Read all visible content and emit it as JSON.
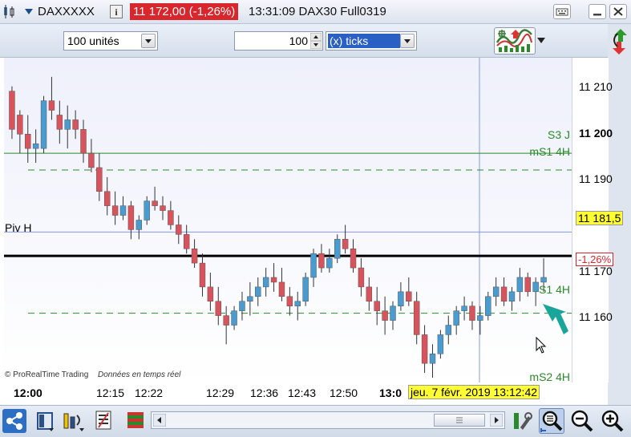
{
  "window": {
    "title_symbol": "DAXXXXX",
    "price_badge": "11 172,00 (-1,26%)",
    "time_and_instrument": "13:31:09 DAX30 Full0319",
    "price_badge_color": "#d9262c",
    "icons": [
      "drag-handle-icon",
      "dropdown-arrow-icon",
      "info-icon",
      "keyboard-icon",
      "minimize-icon",
      "close-icon"
    ]
  },
  "toolbar": {
    "units_select": "100 unités",
    "ticks_value": "100",
    "ticks_mode_select": "(x) ticks",
    "icons": [
      "indicator-chart-icon",
      "menu-arrow-icon",
      "undock-icon"
    ]
  },
  "chart": {
    "watermark": "© ProRealTime Trading",
    "realtime_note": "Données en temps réel",
    "levels": {
      "s3j": "S3 J",
      "ms1_4h": "mS1 4H",
      "piv_h": "Piv H",
      "s1_4h": "S1 4H",
      "ms2_4h": "mS2 4H"
    },
    "y_axis": {
      "ticks": [
        "11 210",
        "11 200",
        "11 190",
        "11 181,5",
        "11 170",
        "11 160"
      ],
      "bold_tick": "11 200",
      "current_price_label": "11 181,5",
      "change_label": "-1,26%"
    },
    "x_axis": {
      "ticks": [
        "12:00",
        "12:15",
        "12:22",
        "12:29",
        "12:36",
        "12:43",
        "12:50",
        "13:0"
      ],
      "cursor_date": "jeu. 7 févr. 2019 13:12:42"
    },
    "colors": {
      "up": "#4a9bcf",
      "down": "#d9535c",
      "support_line": "#2a8a2a",
      "pivot_line": "#000000",
      "cursor_line": "#8899dd",
      "arrow": "#1aa59a"
    }
  },
  "chart_data": {
    "type": "candlestick",
    "ylim": [
      11150,
      11218
    ],
    "y_ticks": [
      11210,
      11200,
      11190,
      11170,
      11160
    ],
    "horizontal_levels": [
      {
        "name": "S3 J",
        "value": 11198
      },
      {
        "name": "mS1 4H",
        "value": 11194.5
      },
      {
        "name": "Piv H",
        "value": 11176.5
      },
      {
        "name": "S1 4H",
        "value": 11164.5
      },
      {
        "name": "mS2 4H",
        "value": 11148
      }
    ],
    "current_price": 11181.5,
    "x": [
      "12:00",
      "12:15",
      "12:22",
      "12:29",
      "12:36",
      "12:43",
      "12:50",
      "13:0"
    ],
    "candles": [
      [
        11211,
        11212,
        11201,
        11203
      ],
      [
        11206,
        11207,
        11198,
        11202
      ],
      [
        11202,
        11206,
        11196,
        11199
      ],
      [
        11199,
        11203,
        11196,
        11200
      ],
      [
        11199,
        11210,
        11198,
        11209
      ],
      [
        11209,
        11214,
        11205,
        11207
      ],
      [
        11206,
        11209,
        11200,
        11203
      ],
      [
        11203,
        11208,
        11199,
        11205
      ],
      [
        11205,
        11207,
        11201,
        11203
      ],
      [
        11203,
        11205,
        11196,
        11198
      ],
      [
        11198,
        11201,
        11194,
        11195
      ],
      [
        11195,
        11198,
        11188,
        11190
      ],
      [
        11190,
        11193,
        11185,
        11187
      ],
      [
        11187,
        11190,
        11183,
        11185
      ],
      [
        11185,
        11189,
        11184,
        11187
      ],
      [
        11187,
        11188,
        11180,
        11182
      ],
      [
        11182,
        11185,
        11180,
        11184
      ],
      [
        11184,
        11189,
        11183,
        11188
      ],
      [
        11188,
        11191,
        11186,
        11187
      ],
      [
        11187,
        11189,
        11184,
        11186
      ],
      [
        11186,
        11188,
        11182,
        11183
      ],
      [
        11183,
        11185,
        11179,
        11181
      ],
      [
        11181,
        11183,
        11177,
        11178
      ],
      [
        11178,
        11180,
        11174,
        11175
      ],
      [
        11175,
        11177,
        11168,
        11170
      ],
      [
        11170,
        11173,
        11165,
        11167
      ],
      [
        11167,
        11170,
        11162,
        11164
      ],
      [
        11164,
        11166,
        11158,
        11162
      ],
      [
        11162,
        11166,
        11161,
        11165
      ],
      [
        11165,
        11169,
        11163,
        11167
      ],
      [
        11167,
        11171,
        11164,
        11168
      ],
      [
        11168,
        11172,
        11166,
        11170
      ],
      [
        11170,
        11174,
        11168,
        11172
      ],
      [
        11172,
        11175,
        11169,
        11171
      ],
      [
        11171,
        11174,
        11167,
        11168
      ],
      [
        11168,
        11170,
        11164,
        11166
      ],
      [
        11166,
        11169,
        11163,
        11167
      ],
      [
        11167,
        11173,
        11166,
        11172
      ],
      [
        11172,
        11178,
        11170,
        11177
      ],
      [
        11177,
        11179,
        11173,
        11174
      ],
      [
        11174,
        11178,
        11173,
        11176
      ],
      [
        11176,
        11181,
        11175,
        11180
      ],
      [
        11180,
        11183,
        11177,
        11178
      ],
      [
        11178,
        11180,
        11173,
        11174
      ],
      [
        11174,
        11176,
        11168,
        11170
      ],
      [
        11170,
        11172,
        11165,
        11167
      ],
      [
        11167,
        11170,
        11162,
        11165
      ],
      [
        11165,
        11168,
        11160,
        11163
      ],
      [
        11163,
        11167,
        11161,
        11166
      ],
      [
        11166,
        11171,
        11165,
        11169
      ],
      [
        11169,
        11172,
        11166,
        11167
      ],
      [
        11167,
        11169,
        11158,
        11160
      ],
      [
        11160,
        11162,
        11152,
        11154
      ],
      [
        11154,
        11158,
        11151,
        11156
      ],
      [
        11156,
        11161,
        11155,
        11160
      ],
      [
        11160,
        11164,
        11158,
        11162
      ],
      [
        11162,
        11166,
        11160,
        11165
      ],
      [
        11165,
        11168,
        11163,
        11166
      ],
      [
        11166,
        11167,
        11161,
        11163
      ],
      [
        11163,
        11166,
        11160,
        11164
      ],
      [
        11164,
        11169,
        11163,
        11168
      ],
      [
        11168,
        11172,
        11166,
        11170
      ],
      [
        11170,
        11172,
        11166,
        11167
      ],
      [
        11167,
        11170,
        11165,
        11169
      ],
      [
        11169,
        11174,
        11167,
        11172
      ],
      [
        11172,
        11173,
        11168,
        11169
      ],
      [
        11169,
        11172,
        11166,
        11171
      ],
      [
        11171,
        11176,
        11169,
        11172
      ]
    ]
  },
  "statusbar": {
    "icons": [
      "share-icon",
      "window-layout-icon",
      "drawing-tools-icon",
      "list-icon",
      "grid-list-icon",
      "scroll-left-icon",
      "scroll-thumb-grip-icon",
      "scroll-right-icon",
      "settings-tools-icon",
      "zoom-fit-icon",
      "zoom-out-icon",
      "zoom-in-icon"
    ]
  }
}
